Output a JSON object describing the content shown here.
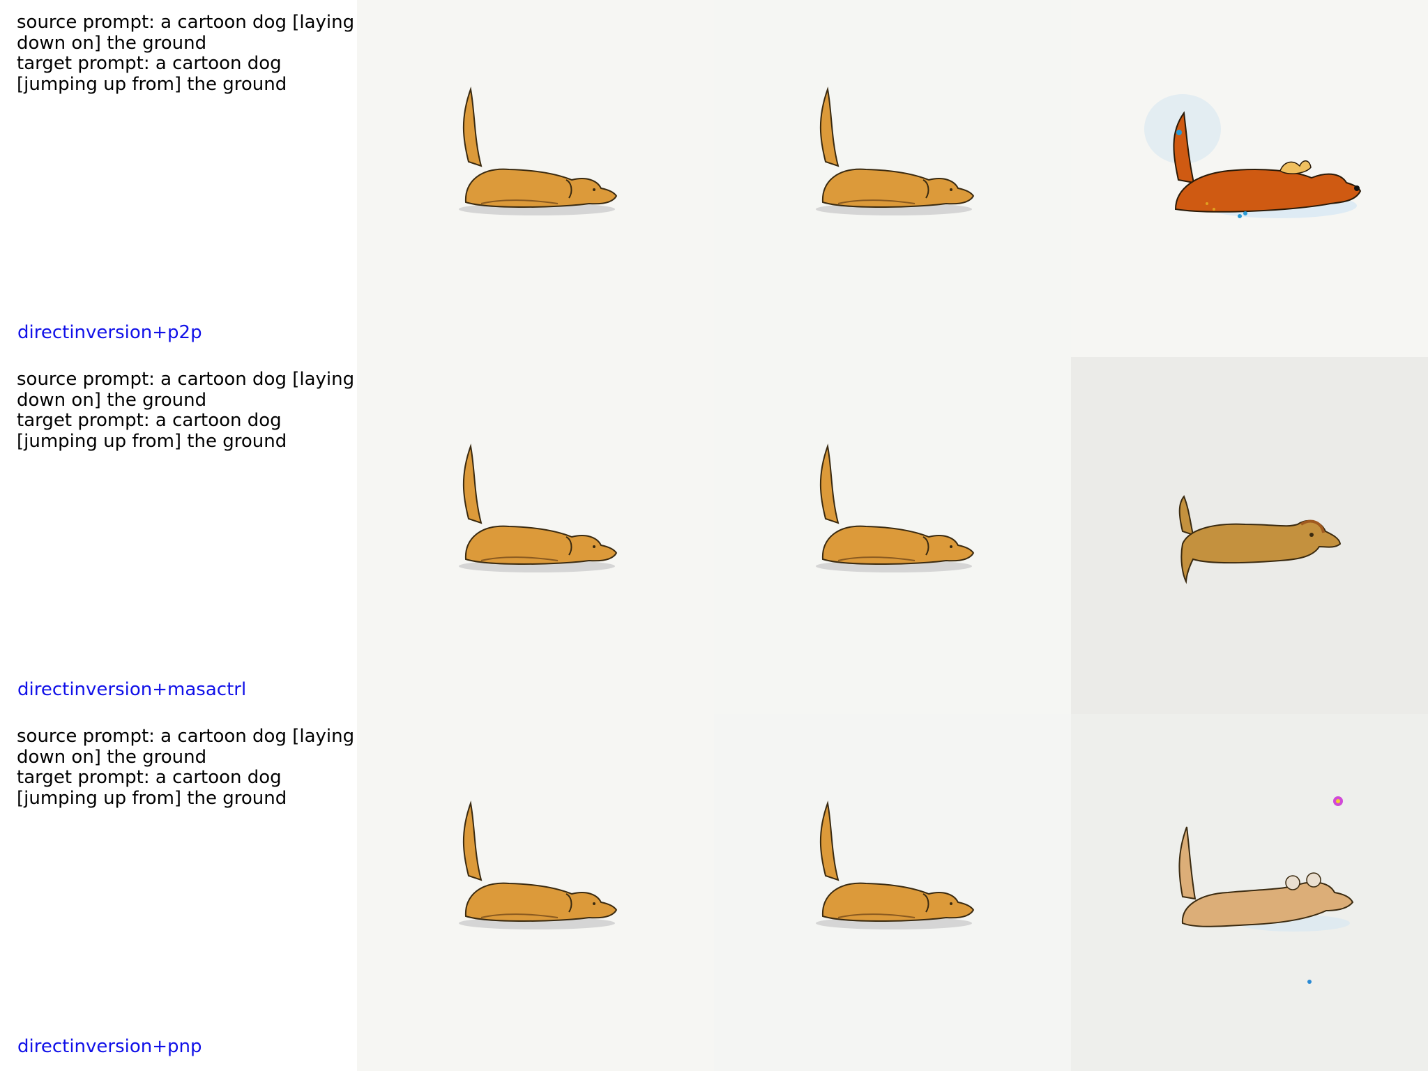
{
  "rows": [
    {
      "prompt_text": "source prompt: a cartoon dog [laying down on] the ground\ntarget prompt: a cartoon dog [jumping up from] the ground",
      "method": "directinversion+p2p"
    },
    {
      "prompt_text": "source prompt: a cartoon dog [laying down on] the ground\ntarget prompt: a cartoon dog [jumping up from] the ground",
      "method": "directinversion+masactrl"
    },
    {
      "prompt_text": "source prompt: a cartoon dog [laying down on] the ground\ntarget prompt: a cartoon dog [jumping up from] the ground",
      "method": "directinversion+pnp"
    }
  ],
  "colors": {
    "method_label": "#1010e8",
    "dog_orange": "#dc9a3a",
    "dog_dark_orange": "#cf5a12",
    "dog_dull": "#c4913e",
    "dog_light": "#dcae78",
    "panel_bg": "#f6f6f3",
    "panel_bg_gray": "#ececea"
  }
}
